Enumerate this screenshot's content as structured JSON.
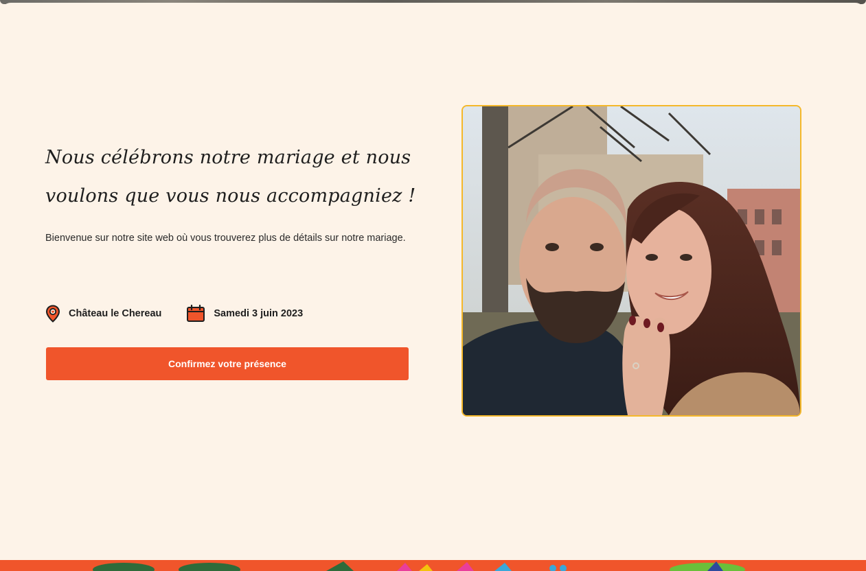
{
  "hero": {
    "headline_line1": "Nous célébrons notre mariage et nous",
    "headline_line2": "voulons que vous nous accompagniez !",
    "intro": "Bienvenue sur notre site web où vous trouverez plus de détails sur notre mariage.",
    "location_icon": "map-pin-icon",
    "location": "Château le Chereau",
    "date_icon": "calendar-icon",
    "date": "Samedi 3 juin 2023",
    "rsvp_label": "Confirmez votre présence"
  },
  "photo": {
    "subject": "couple-selfie-photo"
  },
  "colors": {
    "background": "#fdf3e8",
    "accent": "#f0552b",
    "photo_border": "#f5b82a",
    "text": "#1e1e1e"
  }
}
